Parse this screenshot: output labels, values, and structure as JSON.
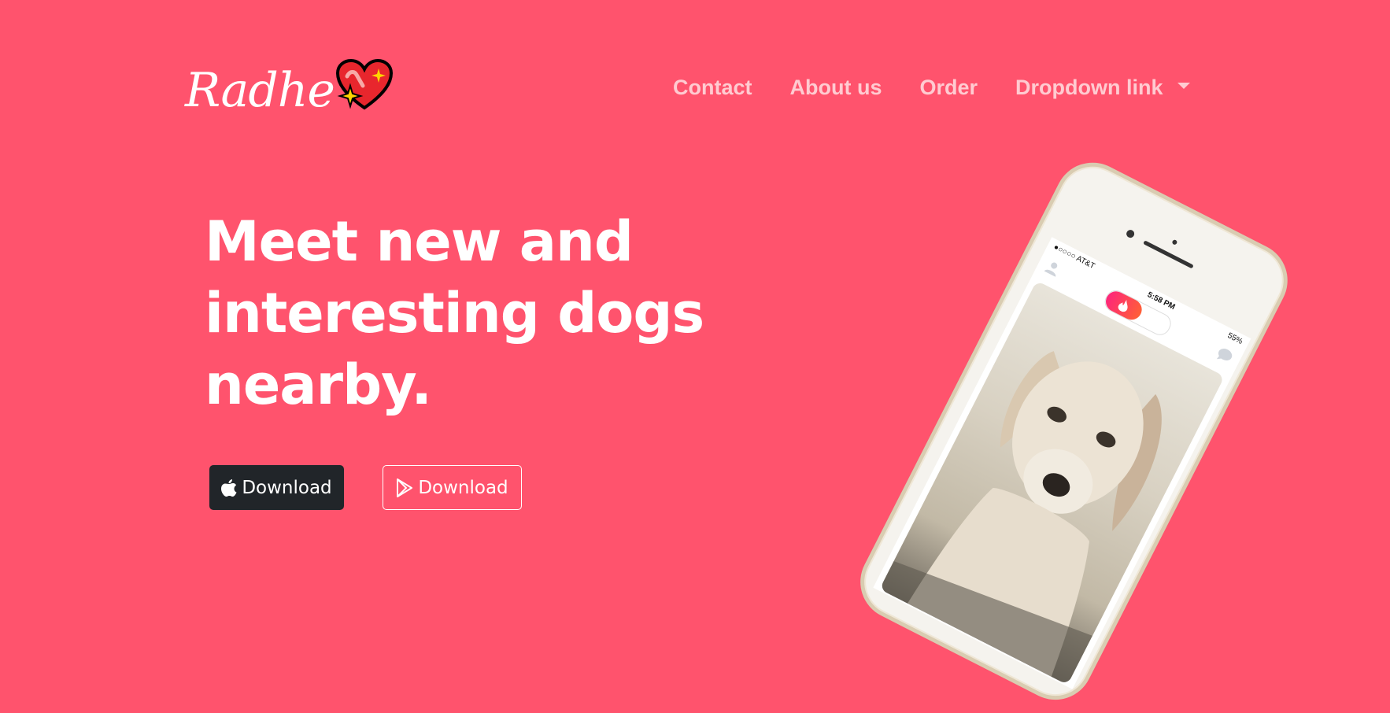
{
  "navbar": {
    "brand": "Radhe",
    "links": [
      {
        "label": "Contact"
      },
      {
        "label": "About us"
      },
      {
        "label": "Order"
      }
    ],
    "dropdown_label": "Dropdown link"
  },
  "hero": {
    "headline": "Meet new and interesting dogs nearby.",
    "buttons": {
      "apple_label": "Download",
      "google_label": "Download"
    }
  },
  "phone": {
    "carrier": "●○○○○ AT&T",
    "time": "5:58 PM",
    "battery": "55%"
  },
  "colors": {
    "background": "#ff536d",
    "nav_link": "#ffcbd1",
    "dark_button": "#212529"
  },
  "icons": [
    "sparkling-heart-icon",
    "apple-icon",
    "google-play-icon",
    "caret-down-icon",
    "flame-icon",
    "profile-icon",
    "chat-icon"
  ]
}
